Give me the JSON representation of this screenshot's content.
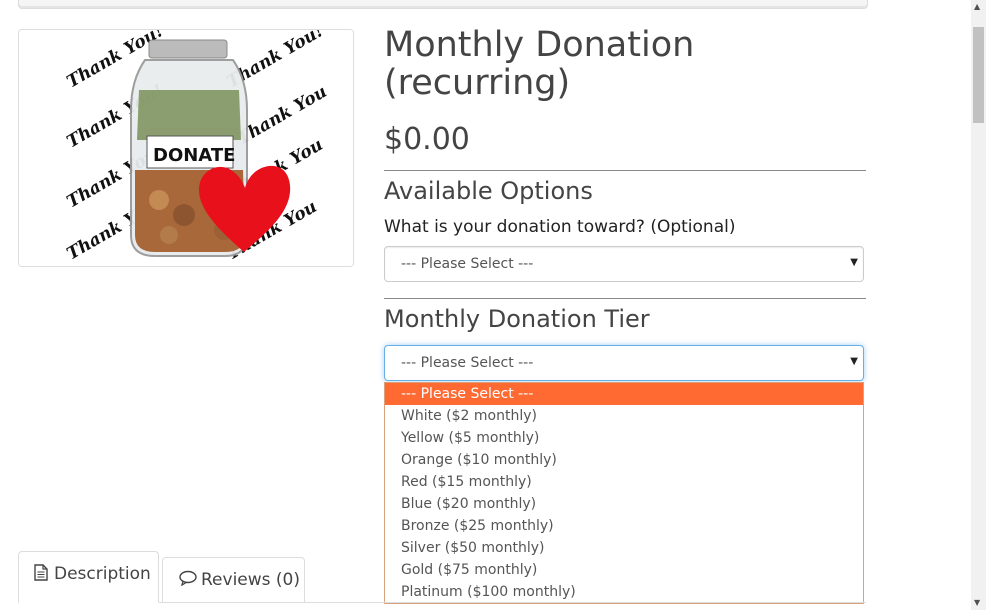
{
  "product": {
    "title": "Monthly Donation (recurring)",
    "price": "$0.00",
    "image_text": {
      "jar_label": "DONATE",
      "background": "Thank You!"
    }
  },
  "options": {
    "heading": "Available Options",
    "donation_toward": {
      "label": "What is your donation toward? (Optional)",
      "selected": "--- Please Select ---"
    }
  },
  "tier": {
    "heading": "Monthly Donation Tier",
    "selected": "--- Please Select ---",
    "options": [
      "--- Please Select ---",
      "White ($2 monthly)",
      "Yellow ($5 monthly)",
      "Orange ($10 monthly)",
      "Red ($15 monthly)",
      "Blue ($20 monthly)",
      "Bronze ($25 monthly)",
      "Silver ($50 monthly)",
      "Gold ($75 monthly)",
      "Platinum ($100 monthly)"
    ]
  },
  "tabs": [
    {
      "label": "Description",
      "icon": "document-icon"
    },
    {
      "label": "Reviews (0)",
      "icon": "comment-icon"
    }
  ],
  "colors": {
    "highlight": "#ff6a33",
    "focus": "#66afe9",
    "heart": "#e8101a"
  }
}
